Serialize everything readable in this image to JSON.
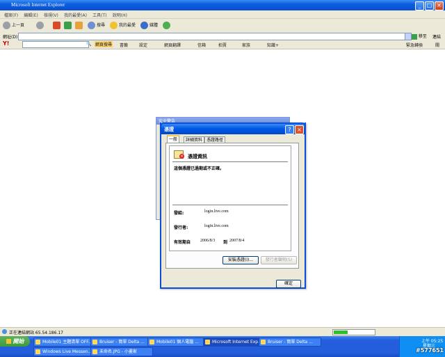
{
  "browser": {
    "title": "Microsoft Internet Explorer",
    "menu": [
      "檔案(F)",
      "編輯(E)",
      "檢視(V)",
      "我的最愛(A)",
      "工具(T)",
      "說明(H)"
    ],
    "toolbar": {
      "back": "上一頁",
      "search": "搜尋",
      "favorites": "我的最愛",
      "media": "媒體"
    },
    "address_label": "網址(D)",
    "address_value": "",
    "go_label": "移至",
    "links_label": "連結",
    "yahoo": {
      "search_btn": "網頁搜尋",
      "items": [
        "書籤",
        "設定",
        "網頁翻譯",
        "信箱",
        "拍賣",
        "家族",
        "知識+"
      ],
      "right": [
        "緊急轉換",
        "關"
      ]
    },
    "status_text": "正在連結網站 65.54.186.17",
    "progress": 0.35
  },
  "dialog_back": {
    "title": "安全警告"
  },
  "dialog": {
    "title": "憑證",
    "tabs": [
      "一般",
      "詳細資料",
      "憑證路徑"
    ],
    "cert_title": "憑證資訊",
    "warning": "這個憑證已過期或不正確。",
    "issued_to_label": "發給:",
    "issued_to_value": "login.live.com",
    "issued_by_label": "發行者:",
    "issued_by_value": "login.live.com",
    "valid_label": "有效期自",
    "valid_from": "2006/8/3",
    "valid_to_word": "到",
    "valid_to": "2007/8/4",
    "install_btn": "安裝憑證(I)...",
    "statement_btn": "發行者聲明(S)",
    "ok_btn": "確定"
  },
  "taskbar": {
    "start": "開始",
    "tasks_row1": [
      "Mobile01 主題清單 OFF...",
      "Bruiser - 簡單 Delta ...",
      "Mobile01 個人電腦 ...",
      "Microsoft Internet Exp...",
      "Bruiser - 簡單 Delta ..."
    ],
    "tasks_row2": [
      "Windows Live Messen...",
      "未命名.JPG - 小畫家"
    ],
    "clock_top": "上午 05:25",
    "clock_bottom": "星期三",
    "watermark": "#577651"
  }
}
